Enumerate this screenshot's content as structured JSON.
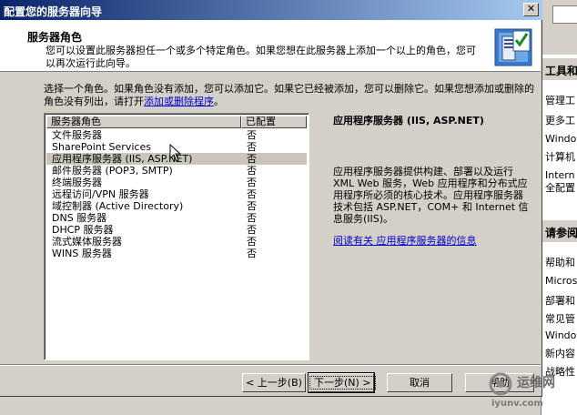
{
  "window": {
    "title": "配置您的服务器向导",
    "close_glyph": "✕"
  },
  "header": {
    "title": "服务器角色",
    "description": "您可以设置此服务器担任一个或多个特定角色。如果您想在此服务器上添加一个以上的角色，您可以再次运行此向导。",
    "icon": "server-wizard-icon"
  },
  "intro": {
    "text": "选择一个角色。如果角色没有添加，您可以添加它。如果它已经被添加，您可以删除它。如果您想添加或删除的角色没有列出，请打开",
    "link_text": "添加或删除程序",
    "suffix": "。"
  },
  "roles_list": {
    "columns": [
      "服务器角色",
      "已配置"
    ],
    "rows": [
      {
        "name": "文件服务器",
        "configured": "否"
      },
      {
        "name": "SharePoint Services",
        "configured": "否"
      },
      {
        "name": "应用程序服务器 (IIS, ASP.NET)",
        "configured": "否"
      },
      {
        "name": "邮件服务器 (POP3, SMTP)",
        "configured": "否"
      },
      {
        "name": "终端服务器",
        "configured": "否"
      },
      {
        "name": "远程访问/VPN 服务器",
        "configured": "否"
      },
      {
        "name": "域控制器 (Active Directory)",
        "configured": "否"
      },
      {
        "name": "DNS 服务器",
        "configured": "否"
      },
      {
        "name": "DHCP 服务器",
        "configured": "否"
      },
      {
        "name": "流式媒体服务器",
        "configured": "否"
      },
      {
        "name": "WINS 服务器",
        "configured": "否"
      }
    ],
    "selected_index": 2
  },
  "details": {
    "title": "应用程序服务器 (IIS, ASP.NET)",
    "description": "应用程序服务器提供构建、部署以及运行 XML Web 服务，Web 应用程序和分布式应用程序所必须的核心技术。应用程序服务器技术包括 ASP.NET，COM+ 和 Internet 信息服务(IIS)。",
    "link": "阅读有关 应用程序服务器的信息"
  },
  "buttons": {
    "back": "< 上一步(B)",
    "next": "下一步(N) >",
    "cancel": "取消",
    "help": "帮助"
  },
  "background_window": {
    "heading1": "工具和",
    "lines1": [
      "管理工",
      "更多工",
      "Window",
      "计算机",
      "Intern",
      "全配置"
    ],
    "heading2": "请参阅",
    "lines2": [
      "帮助和",
      "Micros",
      "部署和",
      "常见管",
      "Window",
      "新内容",
      "战略性"
    ]
  },
  "watermark": {
    "text": "运维网",
    "url": "iyunv.com"
  }
}
